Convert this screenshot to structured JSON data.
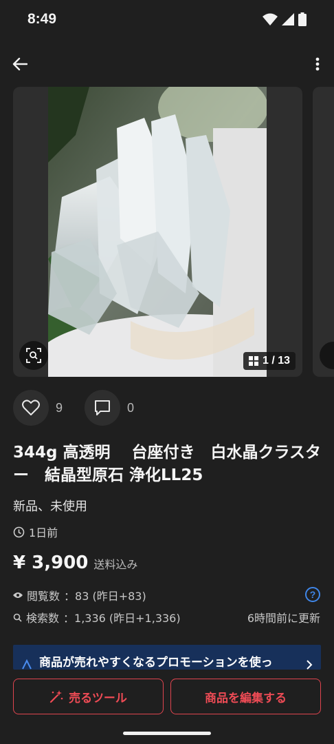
{
  "status_bar": {
    "time": "8:49"
  },
  "image_carousel": {
    "counter": "1 / 13"
  },
  "reactions": {
    "likes": "9",
    "comments": "0"
  },
  "item": {
    "title": "344g 高透明　 台座付き　白水晶クラスター　結晶型原石 浄化LL25",
    "condition": "新品、未使用",
    "posted": "1日前",
    "price": "¥ 3,900",
    "shipping": "送料込み"
  },
  "stats": {
    "views_label": "閲覧数",
    "views_value": "：83 (昨日+83)",
    "search_label": "検索数",
    "search_value": "：1,336 (昨日+1,336)",
    "updated": "6時間前に更新"
  },
  "promo": {
    "text": "商品が売れやすくなるプロモーションを使っ"
  },
  "actions": {
    "sell_tools": "売るツール",
    "edit_item": "商品を編集する"
  },
  "icons": [
    "back-arrow-icon",
    "more-vert-icon",
    "zoom-icon",
    "grid-icon",
    "heart-icon",
    "comment-icon",
    "clock-icon",
    "eye-icon",
    "search-icon",
    "help-icon",
    "magic-wand-icon",
    "chevron-right-icon"
  ],
  "colors": {
    "background": "#1f1f1f",
    "accent": "#e0454f",
    "help": "#3f86e8",
    "promo_bg": "#17305a"
  }
}
